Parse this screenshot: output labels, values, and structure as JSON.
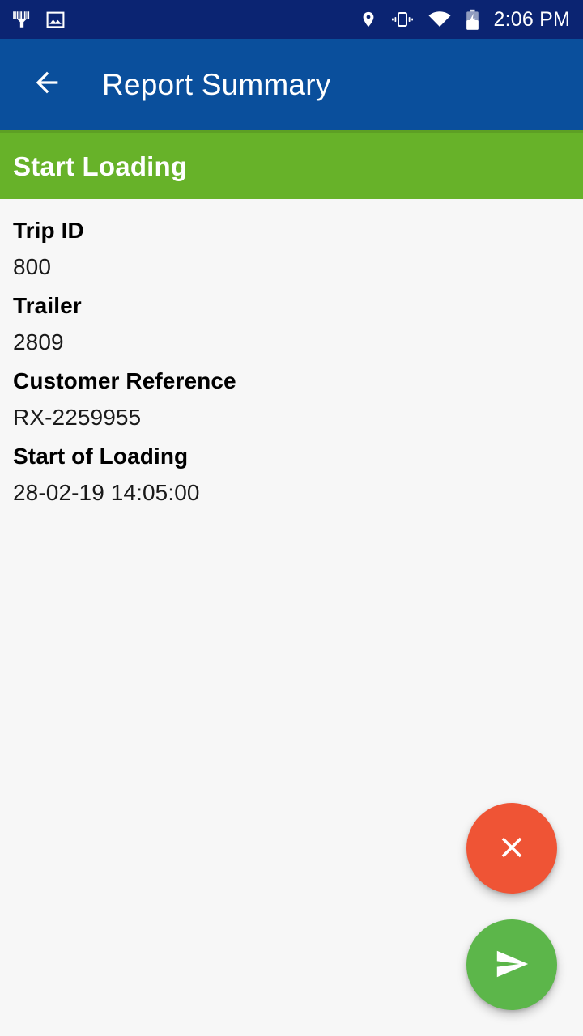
{
  "status_bar": {
    "background_color": "#0b2472",
    "time": "2:06 PM",
    "left_icons": [
      {
        "name": "barcode-scanner-icon"
      },
      {
        "name": "image-icon"
      }
    ],
    "right_icons": [
      {
        "name": "location-pin-icon"
      },
      {
        "name": "vibrate-icon"
      },
      {
        "name": "wifi-icon"
      },
      {
        "name": "battery-charging-icon"
      }
    ]
  },
  "app_bar": {
    "background_color": "#0a4f9c",
    "title": "Report Summary",
    "back_icon": "arrow-left-icon"
  },
  "section": {
    "background_color": "#67b229",
    "title": "Start Loading"
  },
  "details": {
    "fields": [
      {
        "label": "Trip ID",
        "value": "800"
      },
      {
        "label": "Trailer",
        "value": "2809"
      },
      {
        "label": "Customer Reference",
        "value": "RX-2259955"
      },
      {
        "label": "Start of Loading",
        "value": "28-02-19 14:05:00"
      }
    ]
  },
  "actions": {
    "cancel": {
      "icon": "close-icon",
      "color": "#ef5435"
    },
    "send": {
      "icon": "send-icon",
      "color": "#5cb64a"
    }
  }
}
